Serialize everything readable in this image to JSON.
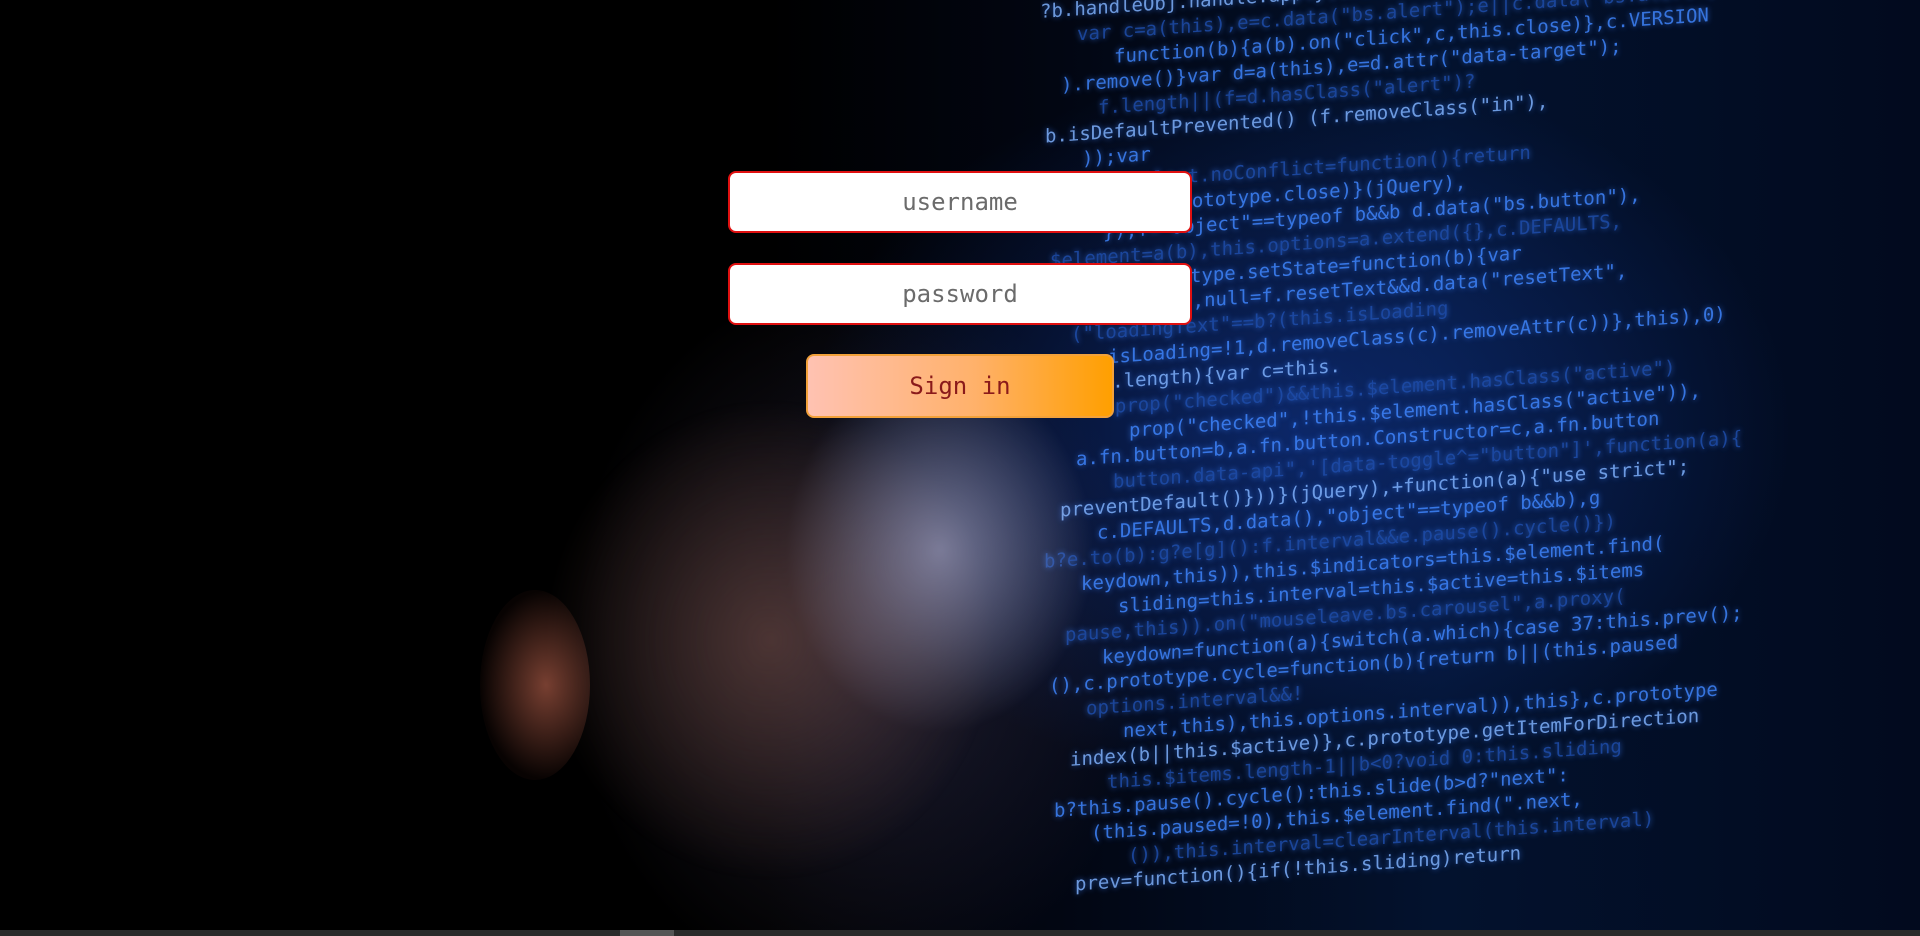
{
  "login": {
    "username_placeholder": "username",
    "password_placeholder": "password",
    "signin_label": "Sign in"
  },
  "background_code": [
    "?b.handleObj.handle.apply(this,",
    "var c=a(this),e=c.data(\"bs.alert\");e||c.data(\"bs.alert\",",
    "function(b){a(b).on(\"click\",c,this.close)},c.VERSION",
    ").remove()}var d=a(this),e=d.attr(\"data-target\");",
    "f.length||(f=d.hasClass(\"alert\")?",
    "b.isDefaultPrevented() (f.removeClass(\"in\"),",
    "));var",
    "a.alert.noConflict=function(){return",
    "api\",c,d.prototype.close)}(jQuery),",
    "}),f=\"object\"==typeof b&&b d.data(\"bs.button\"),",
    "$element=a(b),this.options=a.extend({},c.DEFAULTS,",
    "},c.prototype.setState=function(b){var",
    "\"Text\",null=f.resetText&&d.data(\"resetText\",",
    "(\"loadingText\"==b?(this.isLoading",
    "isLoading=!1,d.removeClass(c).removeAttr(c))},this),0)",
    ";if(b.length){var c=this.",
    "c.prop(\"checked\")&&this.$element.hasClass(\"active\")",
    "prop(\"checked\",!this.$element.hasClass(\"active\")),",
    "a.fn.button=b,a.fn.button.Constructor=c,a.fn.button",
    "button.data-api\",'[data-toggle^=\"button\"]',function(a){",
    "preventDefault()}))}(jQuery),+function(a){\"use strict\";",
    "c.DEFAULTS,d.data(),\"object\"==typeof b&&b),g",
    "b?e.to(b):g?e[g]():f.interval&&e.pause().cycle()})",
    "keydown,this)),this.$indicators=this.$element.find(",
    "sliding=this.interval=this.$active=this.$items",
    "pause,this)).on(\"mouseleave.bs.carousel\",a.proxy(",
    "keydown=function(a){switch(a.which){case 37:this.prev();",
    "(),c.prototype.cycle=function(b){return b||(this.paused",
    "options.interval&&!",
    "next,this),this.options.interval)),this},c.prototype",
    "index(b||this.$active)},c.prototype.getItemForDirection",
    "this.$items.length-1||b<0?void 0:this.sliding",
    "b?this.pause().cycle():this.slide(b>d?\"next\":",
    "(this.paused=!0),this.$element.find(\".next,",
    "()),this.interval=clearInterval(this.interval)",
    "prev=function(){if(!this.sliding)return"
  ]
}
